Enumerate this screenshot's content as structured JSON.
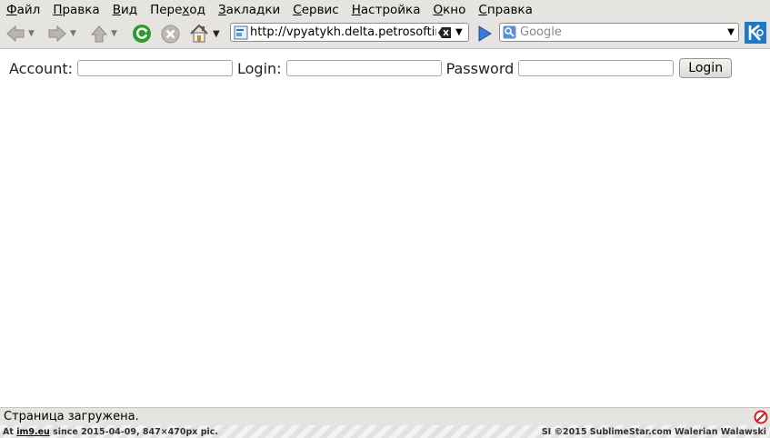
{
  "menu": [
    {
      "pre": "",
      "u": "Ф",
      "post": "айл"
    },
    {
      "pre": "",
      "u": "П",
      "post": "равка"
    },
    {
      "pre": "",
      "u": "В",
      "post": "ид"
    },
    {
      "pre": "Пере",
      "u": "х",
      "post": "од"
    },
    {
      "pre": "",
      "u": "З",
      "post": "акладки"
    },
    {
      "pre": "",
      "u": "С",
      "post": "ервис"
    },
    {
      "pre": "",
      "u": "Н",
      "post": "астройка"
    },
    {
      "pre": "",
      "u": "О",
      "post": "кно"
    },
    {
      "pre": "",
      "u": "С",
      "post": "правка"
    }
  ],
  "toolbar": {
    "icons": [
      "back-arrow-icon",
      "forward-arrow-icon",
      "up-arrow-icon",
      "reload-icon",
      "stop-icon",
      "home-icon",
      "go-arrow-icon",
      "kde-logo-icon"
    ],
    "url": "http://vpyatykh.delta.petrosoftinc",
    "search_placeholder": "Google"
  },
  "form": {
    "account_label": "Account:",
    "login_label": "Login:",
    "password_label": "Password",
    "account_value": "",
    "login_value": "",
    "password_value": "",
    "submit_label": "Login"
  },
  "status": {
    "text": "Страница загружена."
  },
  "footer": {
    "left_prefix": "At",
    "site": "im9.eu",
    "left_suffix": "since 2015-04-09, 847×470px pic.",
    "right": "SI ©2015 SublimeStar.com Walerian Walawski"
  },
  "colors": {
    "chrome": "#e6e4e0",
    "reload_green": "#2e9a2e",
    "kde_blue": "#1d78c8",
    "stop_red": "#d02020"
  }
}
